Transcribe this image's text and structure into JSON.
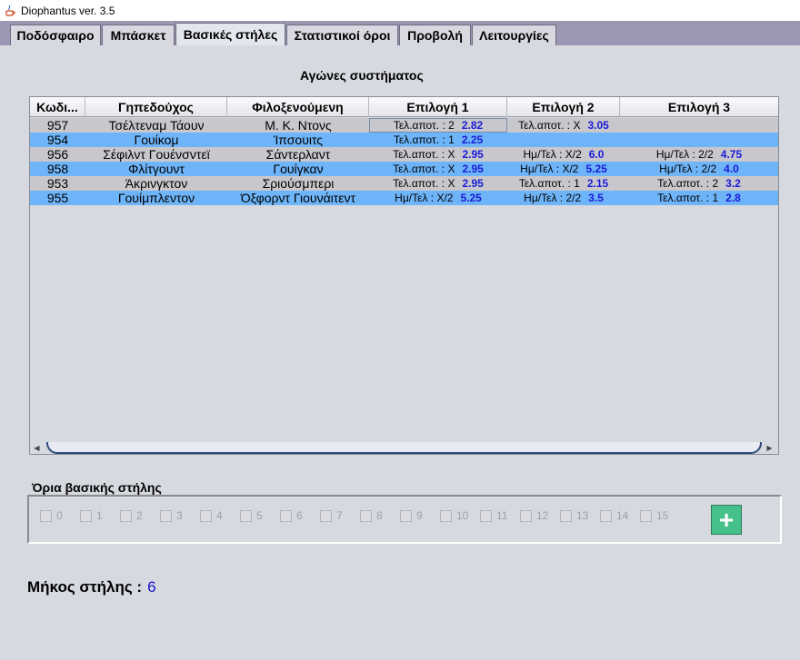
{
  "window": {
    "title": "Diophantus ver. 3.5"
  },
  "tabs": [
    {
      "label": "Ποδόσφαιρο"
    },
    {
      "label": "Μπάσκετ"
    },
    {
      "label": "Βασικές στήλες"
    },
    {
      "label": "Στατιστικοί όροι"
    },
    {
      "label": "Προβολή"
    },
    {
      "label": "Λειτουργίες"
    }
  ],
  "section_title": "Αγώνες συστήματος",
  "table": {
    "headers": [
      "Κωδι...",
      "Γηπεδούχος",
      "Φιλοξενούμενη",
      "Επιλογή 1",
      "Επιλογή 2",
      "Επιλογή 3"
    ],
    "rows": [
      {
        "code": "957",
        "home": "Τσέλτεναμ Τάουν",
        "away": "Μ. Κ. Ντονς",
        "p1_label": "Τελ.αποτ. : 2",
        "p1_odd": "2.82",
        "p2_label": "Τελ.αποτ. : Χ",
        "p2_odd": "3.05",
        "p3_label": "",
        "p3_odd": ""
      },
      {
        "code": "954",
        "home": "Γουίκομ",
        "away": "Ίπσουιτς",
        "p1_label": "Τελ.αποτ. : 1",
        "p1_odd": "2.25",
        "p2_label": "",
        "p2_odd": "",
        "p3_label": "",
        "p3_odd": ""
      },
      {
        "code": "956",
        "home": "Σέφιλντ Γουένσντεϊ",
        "away": "Σάντερλαντ",
        "p1_label": "Τελ.αποτ. : Χ",
        "p1_odd": "2.95",
        "p2_label": "Ημ/Τελ : Χ/2",
        "p2_odd": "6.0",
        "p3_label": "Ημ/Τελ : 2/2",
        "p3_odd": "4.75"
      },
      {
        "code": "958",
        "home": "Φλίτγουντ",
        "away": "Γουίγκαν",
        "p1_label": "Τελ.αποτ. : Χ",
        "p1_odd": "2.95",
        "p2_label": "Ημ/Τελ : Χ/2",
        "p2_odd": "5.25",
        "p3_label": "Ημ/Τελ : 2/2",
        "p3_odd": "4.0"
      },
      {
        "code": "953",
        "home": "Άκρινγκτον",
        "away": "Σριούσμπερι",
        "p1_label": "Τελ.αποτ. : Χ",
        "p1_odd": "2.95",
        "p2_label": "Τελ.αποτ. : 1",
        "p2_odd": "2.15",
        "p3_label": "Τελ.αποτ. : 2",
        "p3_odd": "3.2"
      },
      {
        "code": "955",
        "home": "Γουίμπλεντον",
        "away": "Όξφορντ Γιουνάιτεντ",
        "p1_label": "Ημ/Τελ : Χ/2",
        "p1_odd": "5.25",
        "p2_label": "Ημ/Τελ : 2/2",
        "p2_odd": "3.5",
        "p3_label": "Τελ.αποτ. : 1",
        "p3_odd": "2.8"
      }
    ]
  },
  "limits": {
    "title": "Όρια βασικής στήλης",
    "options": [
      "0",
      "1",
      "2",
      "3",
      "4",
      "5",
      "6",
      "7",
      "8",
      "9",
      "10",
      "11",
      "12",
      "13",
      "14",
      "15"
    ],
    "add_button_icon": "plus-icon"
  },
  "length": {
    "label": "Μήκος στήλης :",
    "value": "6"
  },
  "colors": {
    "row_odd": "#c8c8cc",
    "row_even": "#6eb4f8",
    "odd_value": "#1a1ad8",
    "add_button": "#46c08a",
    "tab_bar": "#9c98b4"
  }
}
